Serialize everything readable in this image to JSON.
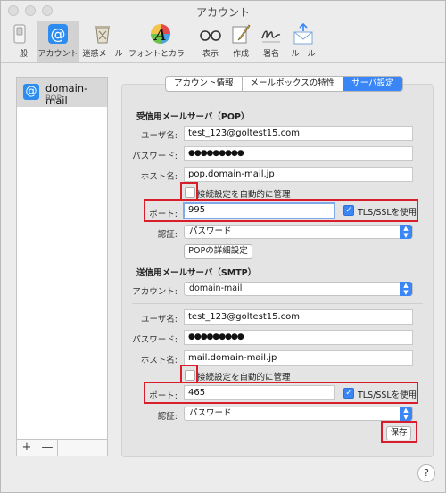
{
  "window": {
    "title": "アカウント"
  },
  "toolbar": {
    "items": [
      {
        "label": "一般",
        "icon": "switch-icon"
      },
      {
        "label": "アカウント",
        "icon": "at-icon"
      },
      {
        "label": "迷惑メール",
        "icon": "junk-trash-icon"
      },
      {
        "label": "フォントとカラー",
        "icon": "font-color-icon"
      },
      {
        "label": "表示",
        "icon": "glasses-icon"
      },
      {
        "label": "作成",
        "icon": "compose-icon"
      },
      {
        "label": "署名",
        "icon": "signature-icon"
      },
      {
        "label": "ルール",
        "icon": "rules-envelope-icon"
      }
    ],
    "selected": "アカウント"
  },
  "sidebar": {
    "accounts": [
      {
        "name": "domain-mail",
        "type": "POP"
      }
    ],
    "add_label": "+",
    "remove_label": "—"
  },
  "tabs": [
    {
      "label": "アカウント情報",
      "active": false
    },
    {
      "label": "メールボックスの特性",
      "active": false
    },
    {
      "label": "サーバ設定",
      "active": true
    }
  ],
  "pop": {
    "section_title": "受信用メールサーバ（POP）",
    "username_label": "ユーザ名:",
    "username": "test_123@goltest15.com",
    "password_label": "パスワード:",
    "password": "●●●●●●●●●",
    "host_label": "ホスト名:",
    "host": "pop.domain-mail.jp",
    "auto_manage_label": "接続設定を自動的に管理",
    "auto_manage_checked": false,
    "port_label": "ポート:",
    "port": "995",
    "tls_label": "TLS/SSLを使用",
    "tls_checked": true,
    "auth_label": "認証:",
    "auth_value": "パスワード",
    "advanced_button": "POPの詳細設定"
  },
  "smtp": {
    "section_title": "送信用メールサーバ（SMTP）",
    "account_label": "アカウント:",
    "account_value": "domain-mail",
    "username_label": "ユーザ名:",
    "username": "test_123@goltest15.com",
    "password_label": "パスワード:",
    "password": "●●●●●●●●●",
    "host_label": "ホスト名:",
    "host": "mail.domain-mail.jp",
    "auto_manage_label": "接続設定を自動的に管理",
    "auto_manage_checked": false,
    "port_label": "ポート:",
    "port": "465",
    "tls_label": "TLS/SSLを使用",
    "tls_checked": true,
    "auth_label": "認証:",
    "auth_value": "パスワード"
  },
  "save_button": "保存",
  "help_label": "?",
  "colors": {
    "accent": "#3b86f7",
    "highlight": "#d81e2a"
  }
}
